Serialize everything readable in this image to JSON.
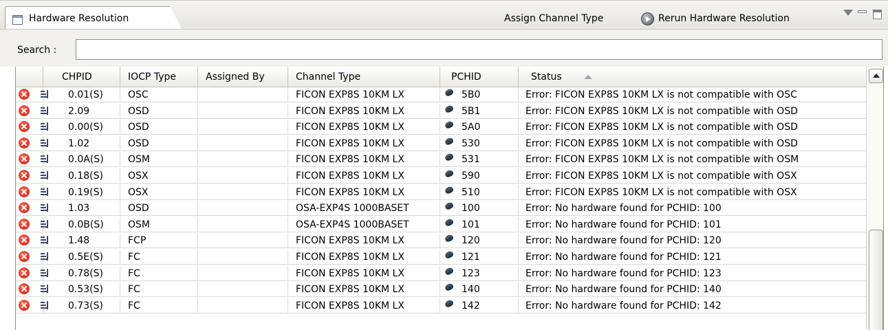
{
  "view": {
    "tab_title": "Hardware Resolution",
    "toolbar": {
      "assign_label": "Assign Channel Type",
      "rerun_label": "Rerun Hardware Resolution"
    }
  },
  "search": {
    "label": "Search :",
    "value": ""
  },
  "table": {
    "columns": [
      "",
      "CHPID",
      "IOCP Type",
      "Assigned By",
      "Channel Type",
      "PCHID",
      "Status"
    ],
    "sort": {
      "column": "Status",
      "direction": "ascending"
    },
    "rows": [
      {
        "chpid": "0.01(S)",
        "iocp": "OSC",
        "assigned": "",
        "channel": "FICON EXP8S 10KM LX",
        "pchid": "5B0",
        "status": "Error: FICON EXP8S 10KM LX is not compatible with OSC"
      },
      {
        "chpid": "2.09",
        "iocp": "OSD",
        "assigned": "",
        "channel": "FICON EXP8S 10KM LX",
        "pchid": "5B1",
        "status": "Error: FICON EXP8S 10KM LX is not compatible with OSD"
      },
      {
        "chpid": "0.00(S)",
        "iocp": "OSD",
        "assigned": "",
        "channel": "FICON EXP8S 10KM LX",
        "pchid": "5A0",
        "status": "Error: FICON EXP8S 10KM LX is not compatible with OSD"
      },
      {
        "chpid": "1.02",
        "iocp": "OSD",
        "assigned": "",
        "channel": "FICON EXP8S 10KM LX",
        "pchid": "530",
        "status": "Error: FICON EXP8S 10KM LX is not compatible with OSD"
      },
      {
        "chpid": "0.0A(S)",
        "iocp": "OSM",
        "assigned": "",
        "channel": "FICON EXP8S 10KM LX",
        "pchid": "531",
        "status": "Error: FICON EXP8S 10KM LX is not compatible with OSM"
      },
      {
        "chpid": "0.18(S)",
        "iocp": "OSX",
        "assigned": "",
        "channel": "FICON EXP8S 10KM LX",
        "pchid": "590",
        "status": "Error: FICON EXP8S 10KM LX is not compatible with OSX"
      },
      {
        "chpid": "0.19(S)",
        "iocp": "OSX",
        "assigned": "",
        "channel": "FICON EXP8S 10KM LX",
        "pchid": "510",
        "status": "Error: FICON EXP8S 10KM LX is not compatible with OSX"
      },
      {
        "chpid": "1.03",
        "iocp": "OSD",
        "assigned": "",
        "channel": "OSA-EXP4S 1000BASET",
        "pchid": "100",
        "status": "Error: No hardware found for PCHID: 100"
      },
      {
        "chpid": "0.0B(S)",
        "iocp": "OSM",
        "assigned": "",
        "channel": "OSA-EXP4S 1000BASET",
        "pchid": "101",
        "status": "Error: No hardware found for PCHID: 101"
      },
      {
        "chpid": "1.48",
        "iocp": "FCP",
        "assigned": "",
        "channel": "FICON EXP8S 10KM LX",
        "pchid": "120",
        "status": "Error: No hardware found for PCHID: 120"
      },
      {
        "chpid": "0.5E(S)",
        "iocp": "FC",
        "assigned": "",
        "channel": "FICON EXP8S 10KM LX",
        "pchid": "121",
        "status": "Error: No hardware found for PCHID: 121"
      },
      {
        "chpid": "0.78(S)",
        "iocp": "FC",
        "assigned": "",
        "channel": "FICON EXP8S 10KM LX",
        "pchid": "123",
        "status": "Error: No hardware found for PCHID: 123"
      },
      {
        "chpid": "0.53(S)",
        "iocp": "FC",
        "assigned": "",
        "channel": "FICON EXP8S 10KM LX",
        "pchid": "140",
        "status": "Error: No hardware found for PCHID: 140"
      },
      {
        "chpid": "0.73(S)",
        "iocp": "FC",
        "assigned": "",
        "channel": "FICON EXP8S 10KM LX",
        "pchid": "142",
        "status": "Error: No hardware found for PCHID: 142"
      }
    ]
  },
  "icons": {
    "row_status": "error-icon",
    "chpid": "channel-path-icon",
    "pchid": "pchid-port-icon",
    "rerun": "run-icon",
    "view_menu": "view-menu-icon",
    "minimize": "minimize-icon",
    "maximize": "maximize-icon"
  },
  "colors": {
    "error": "#c61a0c",
    "header_bg": "#eceae2",
    "row_border": "#d8d8d8"
  }
}
